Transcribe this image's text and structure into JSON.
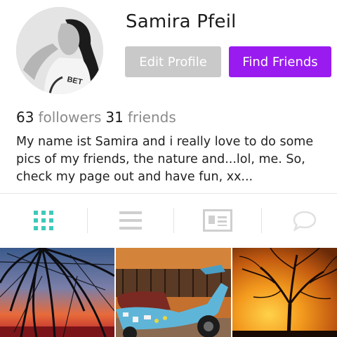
{
  "profile": {
    "username": "Samira Pfeil",
    "shirt_text": "BET",
    "bio": "My name ist Samira and i really love to do some pics of my friends, the nature and...lol, me. So, check my page out and have fun, xx..."
  },
  "actions": {
    "edit_label": "Edit Profile",
    "find_label": "Find Friends"
  },
  "stats": {
    "followers_count": "63",
    "followers_label": "followers",
    "friends_count": "31",
    "friends_label": "friends"
  },
  "tabs": [
    {
      "name": "grid-view",
      "icon": "grid-icon",
      "active": true
    },
    {
      "name": "list-view",
      "icon": "list-icon",
      "active": false
    },
    {
      "name": "profile-card",
      "icon": "id-card-icon",
      "active": false
    },
    {
      "name": "comments",
      "icon": "speech-bubble-icon",
      "active": false
    }
  ],
  "photos": [
    {
      "subject": "palm trees at sunset"
    },
    {
      "subject": "blue scooter on street"
    },
    {
      "subject": "tree silhouette at sunset"
    }
  ],
  "colors": {
    "accent": "#9a1bf0",
    "edit_button": "#c9c9c9",
    "active_tab": "#3fc9b9",
    "inactive_tab": "#cfcfcf"
  }
}
